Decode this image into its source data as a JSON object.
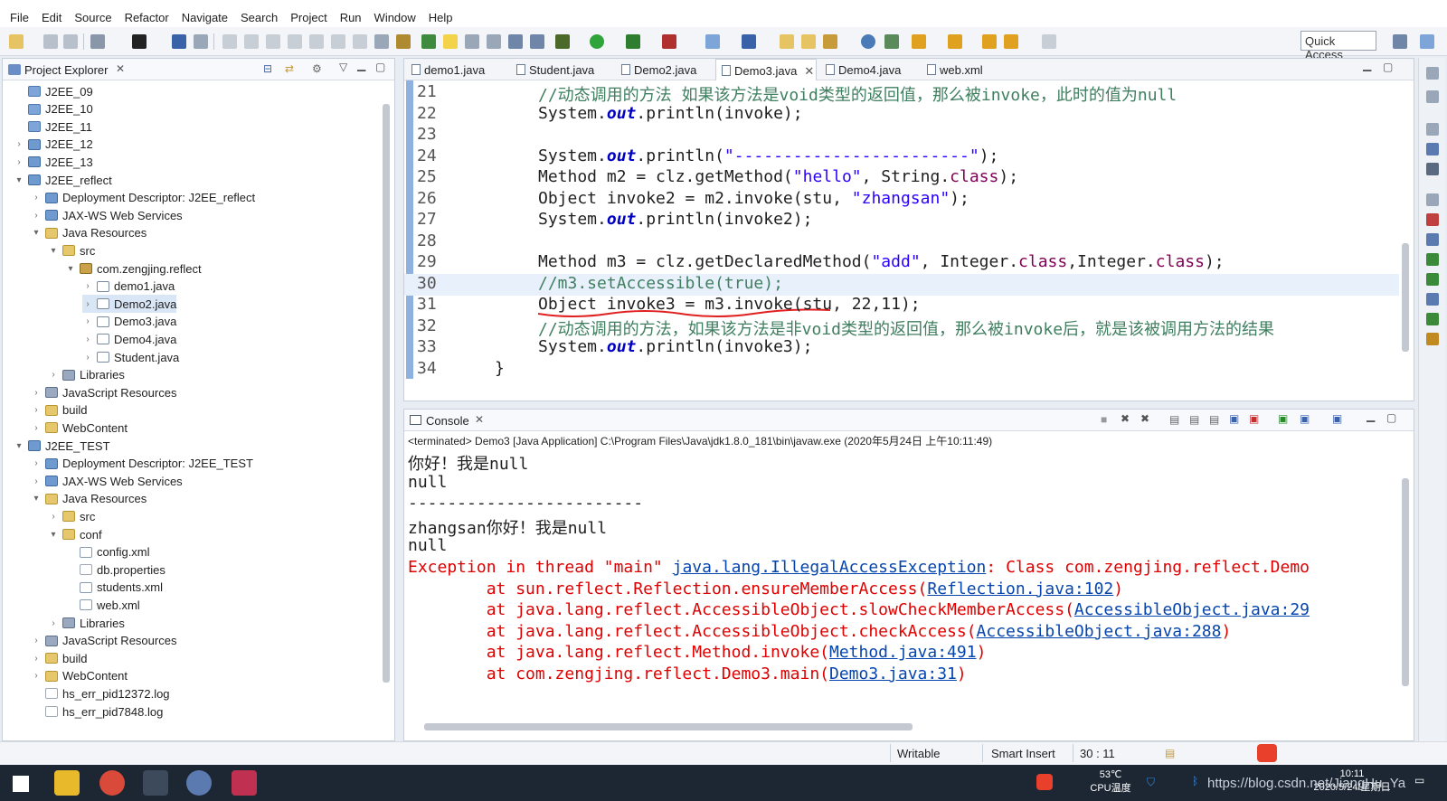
{
  "menubar": {
    "items": [
      "File",
      "Edit",
      "Source",
      "Refactor",
      "Navigate",
      "Search",
      "Project",
      "Run",
      "Window",
      "Help"
    ]
  },
  "toolbar": {
    "quick_access_label": "Quick Access"
  },
  "explorer": {
    "title": "Project Explorer",
    "tree": [
      {
        "label": "J2EE_09",
        "depth": 1,
        "twisty": "",
        "icon": "project"
      },
      {
        "label": "J2EE_10",
        "depth": 1,
        "twisty": "",
        "icon": "project"
      },
      {
        "label": "J2EE_11",
        "depth": 1,
        "twisty": "",
        "icon": "project"
      },
      {
        "label": "J2EE_12",
        "depth": 1,
        "twisty": ">",
        "icon": "web"
      },
      {
        "label": "J2EE_13",
        "depth": 1,
        "twisty": ">",
        "icon": "web"
      },
      {
        "label": "J2EE_reflect",
        "depth": 1,
        "twisty": "v",
        "icon": "web"
      },
      {
        "label": "Deployment Descriptor: J2EE_reflect",
        "depth": 2,
        "twisty": ">",
        "icon": "web"
      },
      {
        "label": "JAX-WS Web Services",
        "depth": 2,
        "twisty": ">",
        "icon": "web"
      },
      {
        "label": "Java Resources",
        "depth": 2,
        "twisty": "v",
        "icon": "folder"
      },
      {
        "label": "src",
        "depth": 3,
        "twisty": "v",
        "icon": "folder"
      },
      {
        "label": "com.zengjing.reflect",
        "depth": 4,
        "twisty": "v",
        "icon": "pkg"
      },
      {
        "label": "demo1.java",
        "depth": 5,
        "twisty": ">",
        "icon": "java"
      },
      {
        "label": "Demo2.java",
        "depth": 5,
        "twisty": ">",
        "icon": "java",
        "selected": true
      },
      {
        "label": "Demo3.java",
        "depth": 5,
        "twisty": ">",
        "icon": "java"
      },
      {
        "label": "Demo4.java",
        "depth": 5,
        "twisty": ">",
        "icon": "java"
      },
      {
        "label": "Student.java",
        "depth": 5,
        "twisty": ">",
        "icon": "java"
      },
      {
        "label": "Libraries",
        "depth": 3,
        "twisty": ">",
        "icon": "lib"
      },
      {
        "label": "JavaScript Resources",
        "depth": 2,
        "twisty": ">",
        "icon": "lib"
      },
      {
        "label": "build",
        "depth": 2,
        "twisty": ">",
        "icon": "folder"
      },
      {
        "label": "WebContent",
        "depth": 2,
        "twisty": ">",
        "icon": "folder"
      },
      {
        "label": "J2EE_TEST",
        "depth": 1,
        "twisty": "v",
        "icon": "web"
      },
      {
        "label": "Deployment Descriptor: J2EE_TEST",
        "depth": 2,
        "twisty": ">",
        "icon": "web"
      },
      {
        "label": "JAX-WS Web Services",
        "depth": 2,
        "twisty": ">",
        "icon": "web"
      },
      {
        "label": "Java Resources",
        "depth": 2,
        "twisty": "v",
        "icon": "folder"
      },
      {
        "label": "src",
        "depth": 3,
        "twisty": ">",
        "icon": "folder"
      },
      {
        "label": "conf",
        "depth": 3,
        "twisty": "v",
        "icon": "folder"
      },
      {
        "label": "config.xml",
        "depth": 4,
        "twisty": "",
        "icon": "xml"
      },
      {
        "label": "db.properties",
        "depth": 4,
        "twisty": "",
        "icon": "file"
      },
      {
        "label": "students.xml",
        "depth": 4,
        "twisty": "",
        "icon": "xml"
      },
      {
        "label": "web.xml",
        "depth": 4,
        "twisty": "",
        "icon": "xml"
      },
      {
        "label": "Libraries",
        "depth": 3,
        "twisty": ">",
        "icon": "lib"
      },
      {
        "label": "JavaScript Resources",
        "depth": 2,
        "twisty": ">",
        "icon": "lib"
      },
      {
        "label": "build",
        "depth": 2,
        "twisty": ">",
        "icon": "folder"
      },
      {
        "label": "WebContent",
        "depth": 2,
        "twisty": ">",
        "icon": "folder"
      },
      {
        "label": "hs_err_pid12372.log",
        "depth": 2,
        "twisty": "",
        "icon": "file"
      },
      {
        "label": "hs_err_pid7848.log",
        "depth": 2,
        "twisty": "",
        "icon": "file"
      }
    ]
  },
  "editor": {
    "tabs": [
      {
        "label": "demo1.java",
        "active": false
      },
      {
        "label": "Student.java",
        "active": false
      },
      {
        "label": "Demo2.java",
        "active": false
      },
      {
        "label": "Demo3.java",
        "active": true
      },
      {
        "label": "Demo4.java",
        "active": false
      },
      {
        "label": "web.xml",
        "active": false
      }
    ],
    "lines": [
      {
        "num": "21",
        "html": "<span class=\"cm\">//动态调用的方法 如果该方法是void类型的返回值，那么被invoke，此时的值为null</span>"
      },
      {
        "num": "22",
        "html": "System.<span class=\"fld\">out</span>.println(invoke);"
      },
      {
        "num": "23",
        "html": ""
      },
      {
        "num": "24",
        "html": "System.<span class=\"fld\">out</span>.println(<span class=\"st\">\"------------------------\"</span>);"
      },
      {
        "num": "25",
        "html": "Method m2 = clz.getMethod(<span class=\"st\">\"hello\"</span>, String.<span class=\"kw\">class</span>);"
      },
      {
        "num": "26",
        "html": "Object invoke2 = m2.invoke(stu, <span class=\"st\">\"zhangsan\"</span>);"
      },
      {
        "num": "27",
        "html": "System.<span class=\"fld\">out</span>.println(invoke2);"
      },
      {
        "num": "28",
        "html": ""
      },
      {
        "num": "29",
        "html": "Method m3 = clz.getDeclaredMethod(<span class=\"st\">\"add\"</span>, Integer.<span class=\"kw\">class</span>,Integer.<span class=\"kw\">class</span>);"
      },
      {
        "num": "30",
        "html": "<span class=\"cm\">//m3.setAccessible(true);</span>",
        "current": true
      },
      {
        "num": "31",
        "html": "Object invoke3 = m3.invoke(stu, 22,11);"
      },
      {
        "num": "32",
        "html": "<span class=\"cm\">//动态调用的方法，如果该方法是非void类型的返回值，那么被invoke后，就是该被调用方法的结果</span>"
      },
      {
        "num": "33",
        "html": "System.<span class=\"fld\">out</span>.println(invoke3);"
      },
      {
        "num": "34",
        "html": "}",
        "indent": "out"
      }
    ]
  },
  "console": {
    "title": "Console",
    "status": "<terminated> Demo3 [Java Application] C:\\Program Files\\Java\\jdk1.8.0_181\\bin\\javaw.exe (2020年5月24日 上午10:11:49)",
    "lines": [
      {
        "html": "你好！我是null",
        "err": false
      },
      {
        "html": "null",
        "err": false
      },
      {
        "html": "------------------------",
        "err": false
      },
      {
        "html": "zhangsan你好！我是null",
        "err": false
      },
      {
        "html": "null",
        "err": false
      },
      {
        "html": "Exception in thread \"main\" <span class=\"lnk\">java.lang.IllegalAccessException</span>: Class com.zengjing.reflect.Demo",
        "err": true
      },
      {
        "html": "        at sun.reflect.Reflection.ensureMemberAccess(<span class=\"lnk\">Reflection.java:102</span>)",
        "err": true
      },
      {
        "html": "        at java.lang.reflect.AccessibleObject.slowCheckMemberAccess(<span class=\"lnk\">AccessibleObject.java:29</span>",
        "err": true
      },
      {
        "html": "        at java.lang.reflect.AccessibleObject.checkAccess(<span class=\"lnk\">AccessibleObject.java:288</span>)",
        "err": true
      },
      {
        "html": "        at java.lang.reflect.Method.invoke(<span class=\"lnk\">Method.java:491</span>)",
        "err": true
      },
      {
        "html": "        at com.zengjing.reflect.Demo3.main(<span class=\"lnk\">Demo3.java:31</span>)",
        "err": true
      }
    ]
  },
  "statusbar": {
    "writable": "Writable",
    "insert_mode": "Smart Insert",
    "position": "30 : 11"
  },
  "taskbar": {
    "temp": "53℃",
    "temp_label": "CPU温度",
    "time": "10:11",
    "date": "2020/5/24/星期日",
    "watermark": "https://blog.csdn.net/JiangHu_Ya"
  },
  "colors": {
    "keyword": "#7f0055",
    "string": "#2a00ff",
    "comment": "#3f7f5f",
    "error": "#e00000"
  }
}
